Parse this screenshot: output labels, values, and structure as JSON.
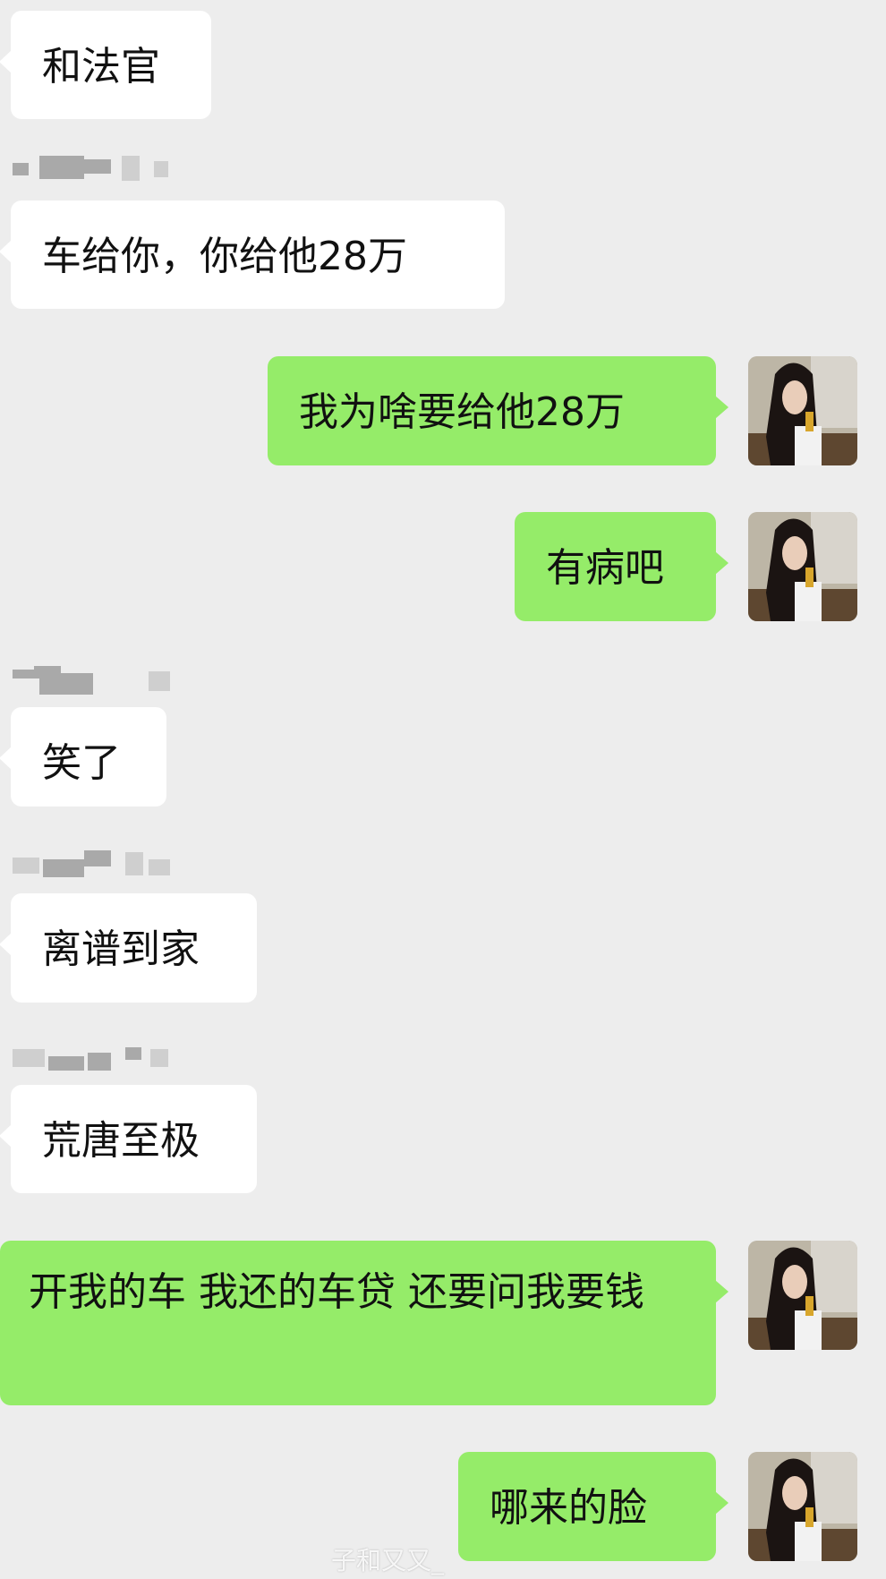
{
  "messages": [
    {
      "text": "和法官"
    },
    {
      "text": "车给你，你给他28万"
    },
    {
      "text": "我为啥要给他28万"
    },
    {
      "text": "有病吧"
    },
    {
      "text": "笑了"
    },
    {
      "text": "离谱到家"
    },
    {
      "text": "荒唐至极"
    },
    {
      "text": "开我的车 我还的车贷 还要问我要钱"
    },
    {
      "text": "哪来的脸"
    }
  ],
  "watermark": "子和又又_",
  "colors": {
    "background": "#ededed",
    "incoming_bubble": "#ffffff",
    "outgoing_bubble": "#95ec69"
  }
}
